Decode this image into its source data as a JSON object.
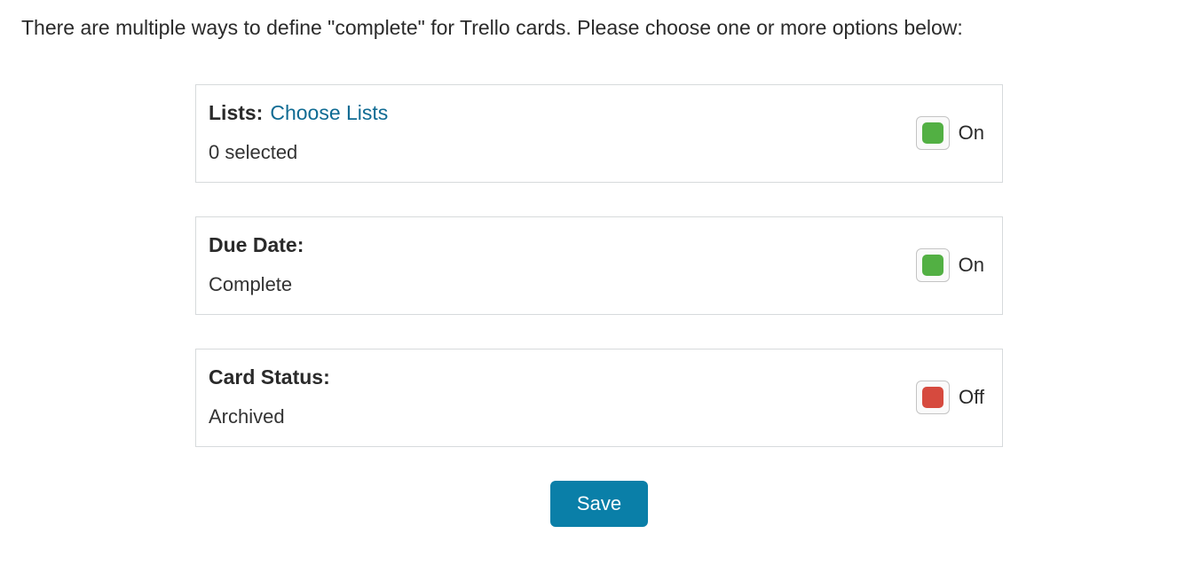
{
  "instruction": "There are multiple ways to define \"complete\" for Trello cards. Please choose one or more options below:",
  "options": {
    "lists": {
      "title": "Lists:",
      "link_text": "Choose Lists",
      "value": "0 selected",
      "toggle_state": "on",
      "toggle_label": "On"
    },
    "due_date": {
      "title": "Due Date:",
      "value": "Complete",
      "toggle_state": "on",
      "toggle_label": "On"
    },
    "card_status": {
      "title": "Card Status:",
      "value": "Archived",
      "toggle_state": "off",
      "toggle_label": "Off"
    }
  },
  "save_label": "Save"
}
